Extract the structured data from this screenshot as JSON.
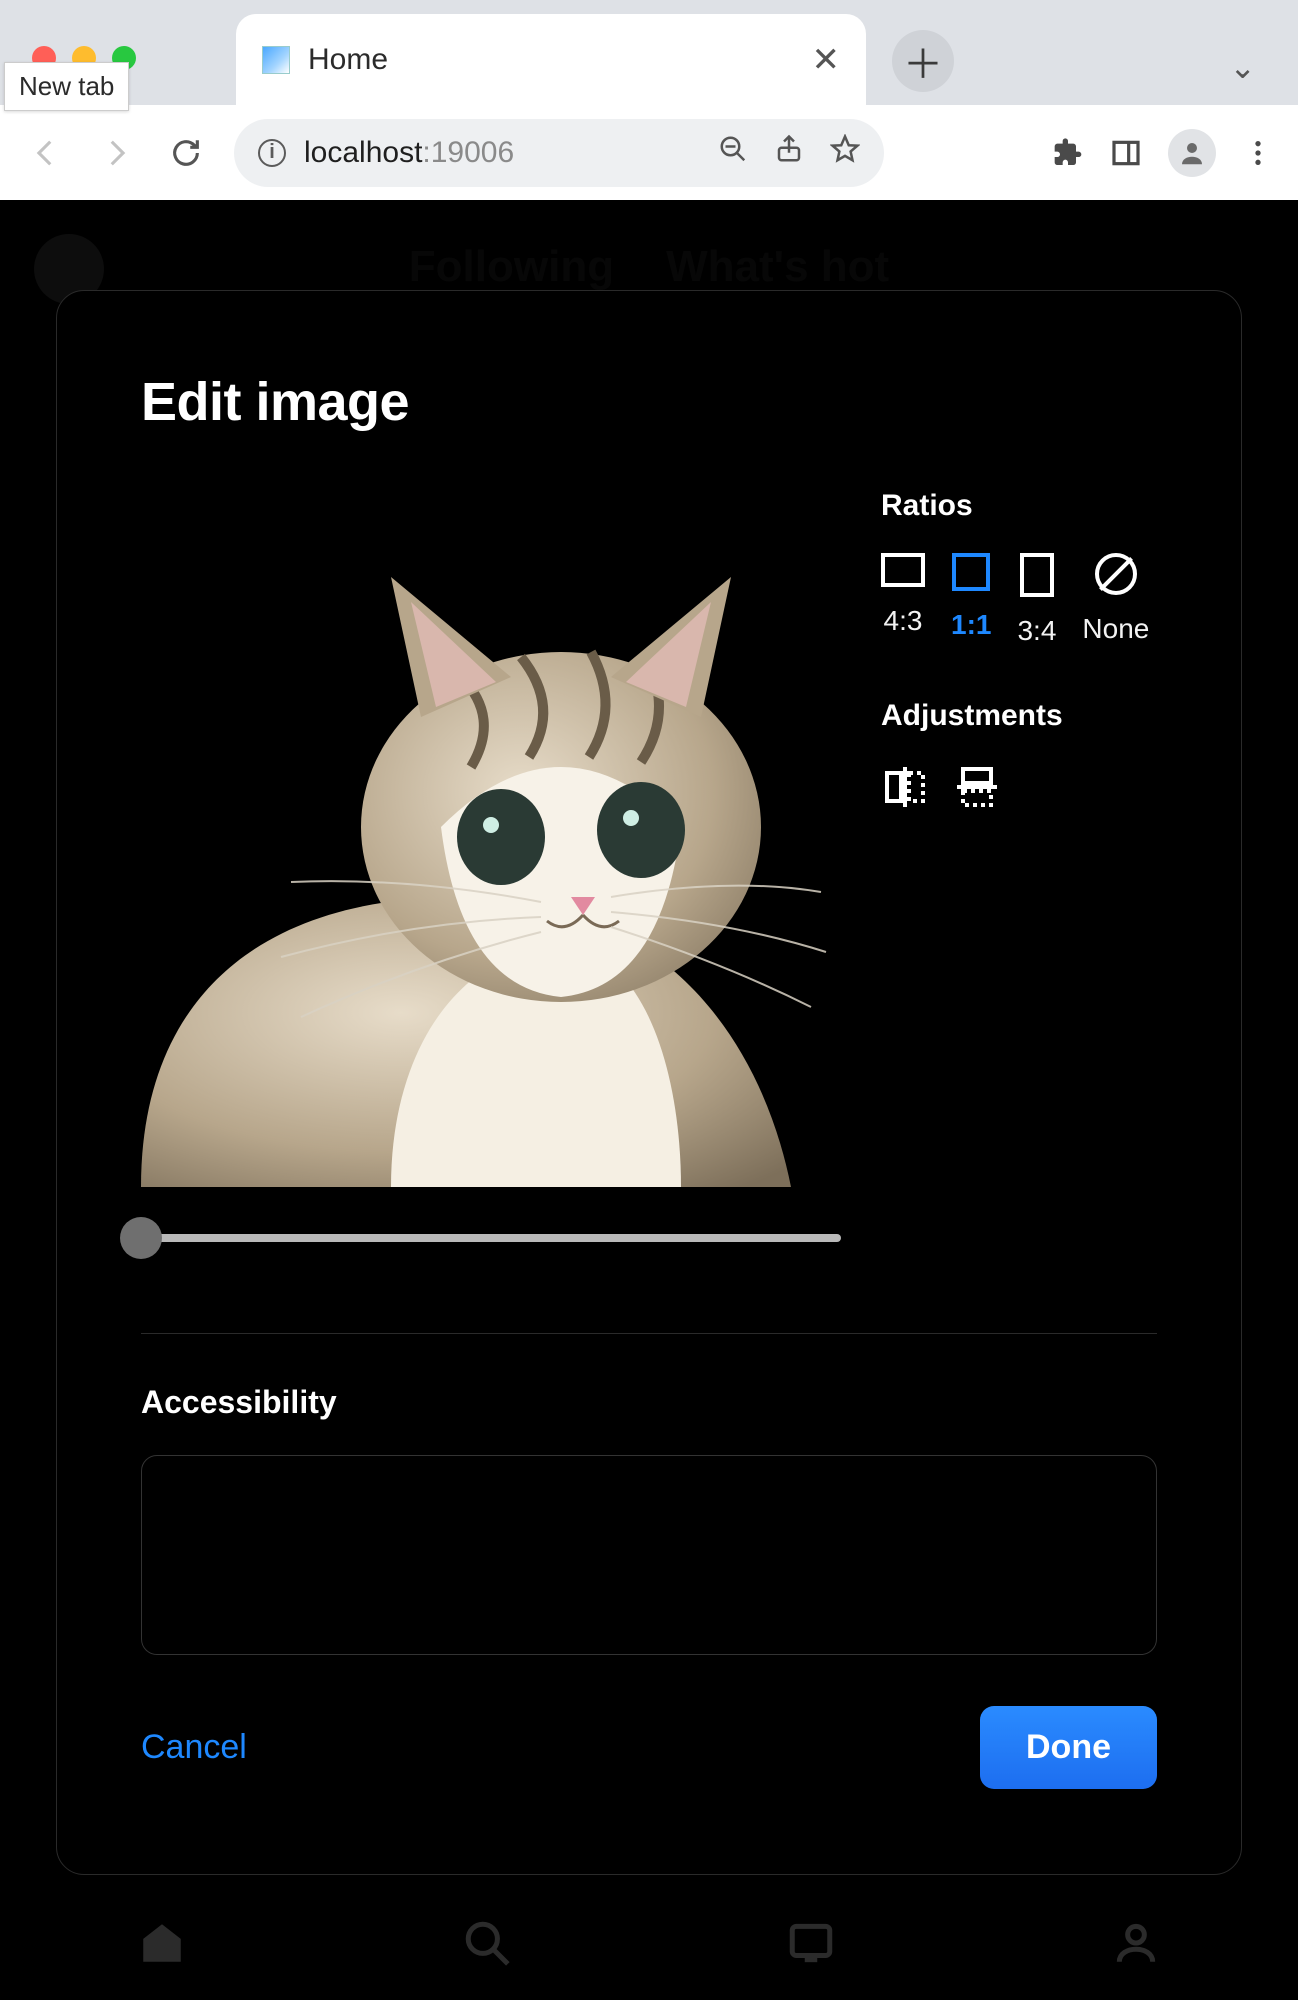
{
  "chrome": {
    "new_tab_tooltip": "New tab",
    "tab_title": "Home",
    "url_host": "localhost",
    "url_port": ":19006"
  },
  "background": {
    "tabs": {
      "following": "Following",
      "whats_hot": "What's hot"
    }
  },
  "modal": {
    "title": "Edit image",
    "ratios_heading": "Ratios",
    "ratios": {
      "r43": "4:3",
      "r11": "1:1",
      "r34": "3:4",
      "none": "None",
      "selected": "1:1"
    },
    "adjustments_heading": "Adjustments",
    "slider_value": 0,
    "accessibility_heading": "Accessibility",
    "accessibility_value": "",
    "cancel": "Cancel",
    "done": "Done"
  }
}
